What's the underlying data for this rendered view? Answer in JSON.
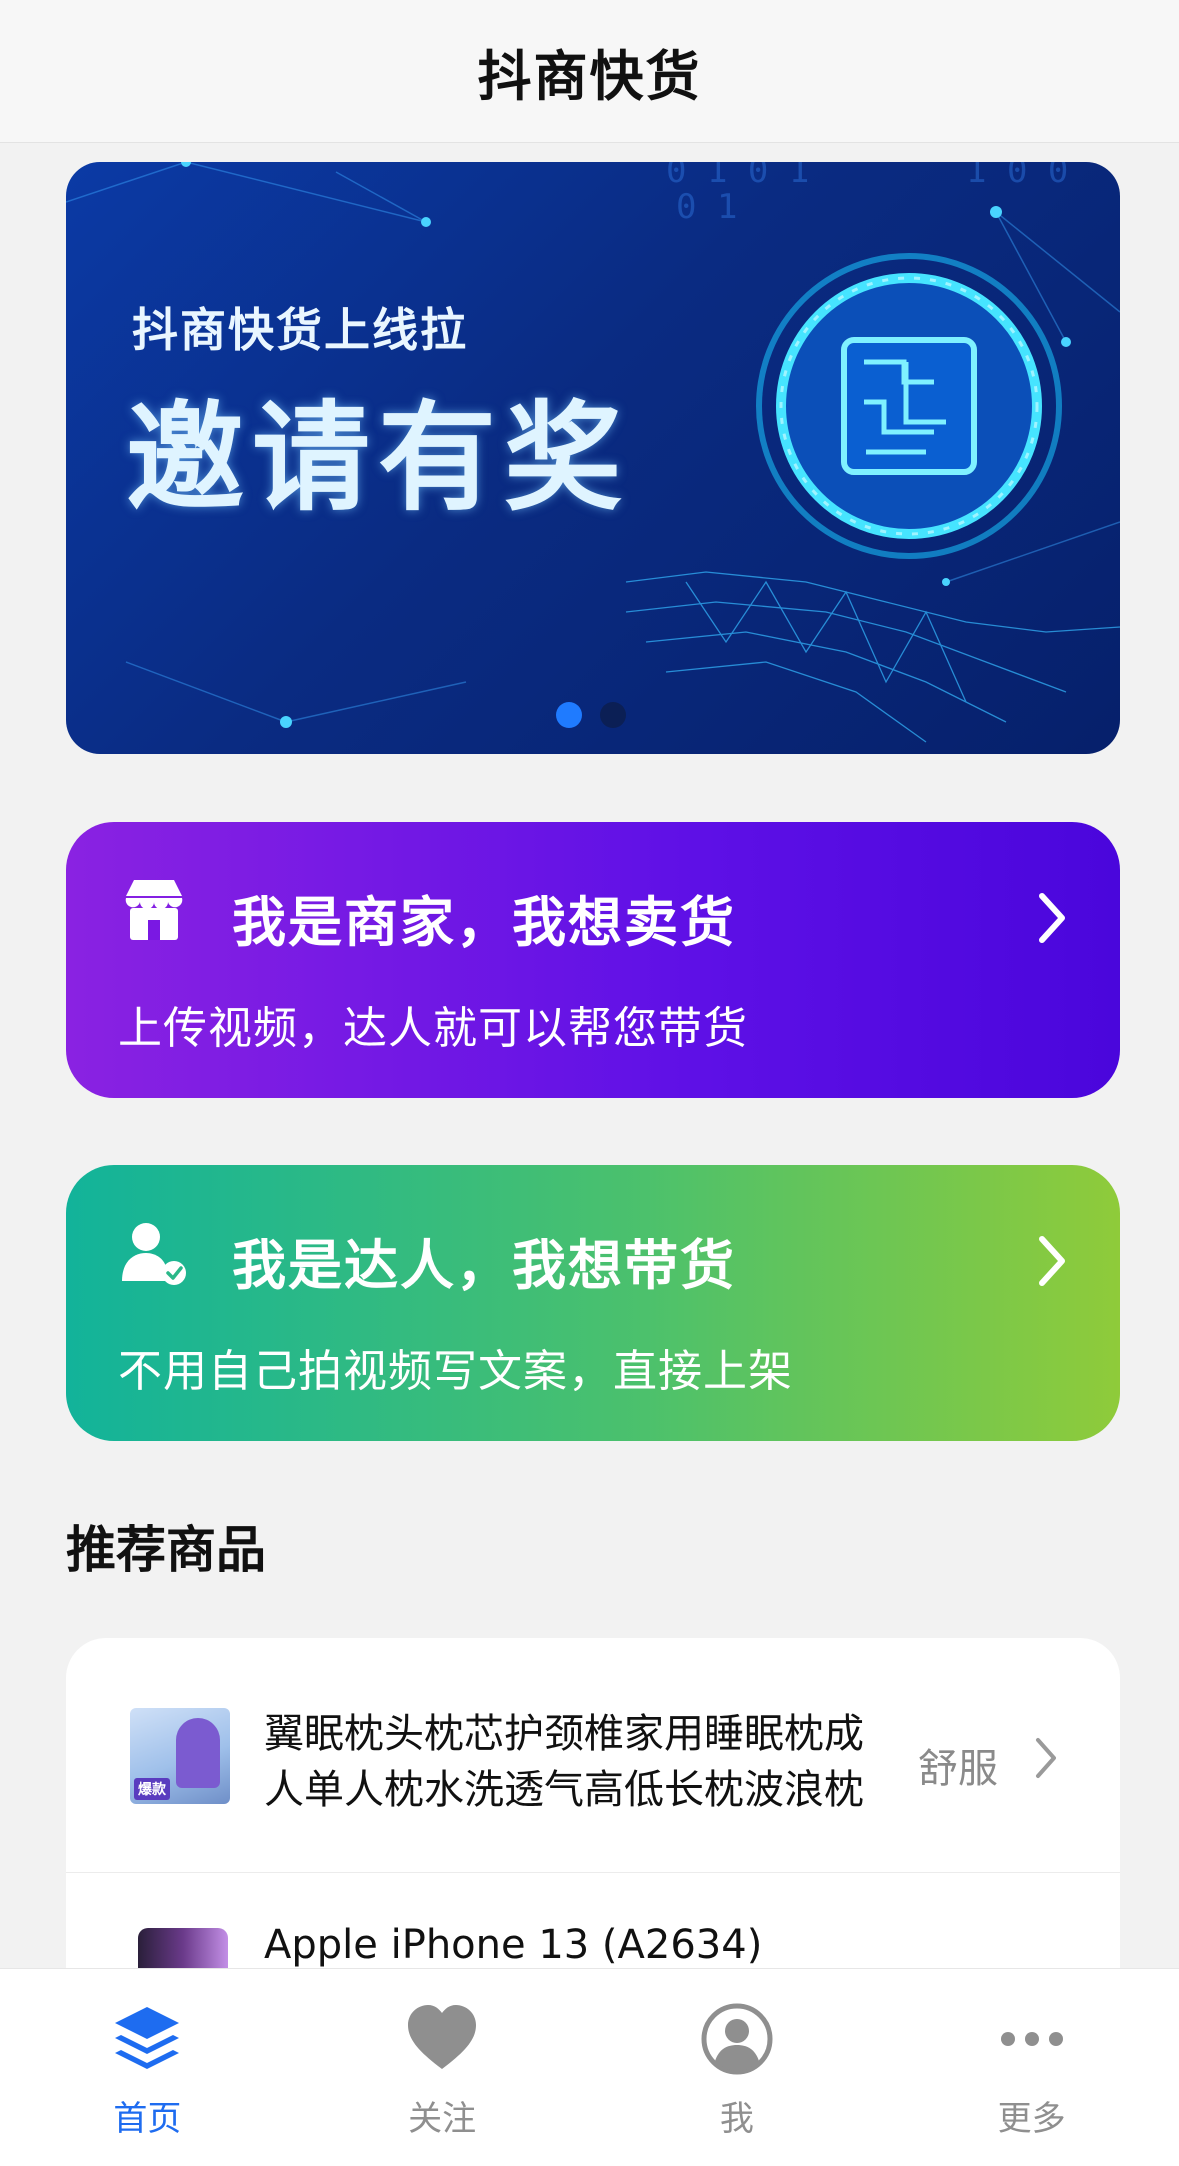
{
  "app": {
    "title": "抖商快货"
  },
  "banner": {
    "subtitle": "抖商快货上线拉",
    "headline": "邀请有奖",
    "page_count": 2,
    "active_page": 1
  },
  "cards": {
    "merchant": {
      "title": "我是商家，我想卖货",
      "subtitle": "上传视频，达人就可以帮您带货",
      "icon": "store-icon"
    },
    "talent": {
      "title": "我是达人，我想带货",
      "subtitle": "不用自己拍视频写文案，直接上架",
      "icon": "user-check-icon"
    }
  },
  "recommend": {
    "title": "推荐商品",
    "items": [
      {
        "title": "翼眠枕头枕芯护颈椎家用睡眠枕成人单人枕水洗透气高低长枕波浪枕",
        "tag": "舒服",
        "badge": "爆款"
      },
      {
        "title": "Apple iPhone 13 (A2634)"
      }
    ]
  },
  "tabbar": {
    "items": [
      {
        "label": "首页",
        "icon": "layers-icon",
        "active": true
      },
      {
        "label": "关注",
        "icon": "heart-icon",
        "active": false
      },
      {
        "label": "我",
        "icon": "profile-icon",
        "active": false
      },
      {
        "label": "更多",
        "icon": "more-icon",
        "active": false
      }
    ]
  },
  "colors": {
    "accent": "#1e6cf0",
    "merchant_gradient": [
      "#8a22e2",
      "#4a06dc"
    ],
    "talent_gradient": [
      "#12b39a",
      "#8fcb3a"
    ]
  }
}
